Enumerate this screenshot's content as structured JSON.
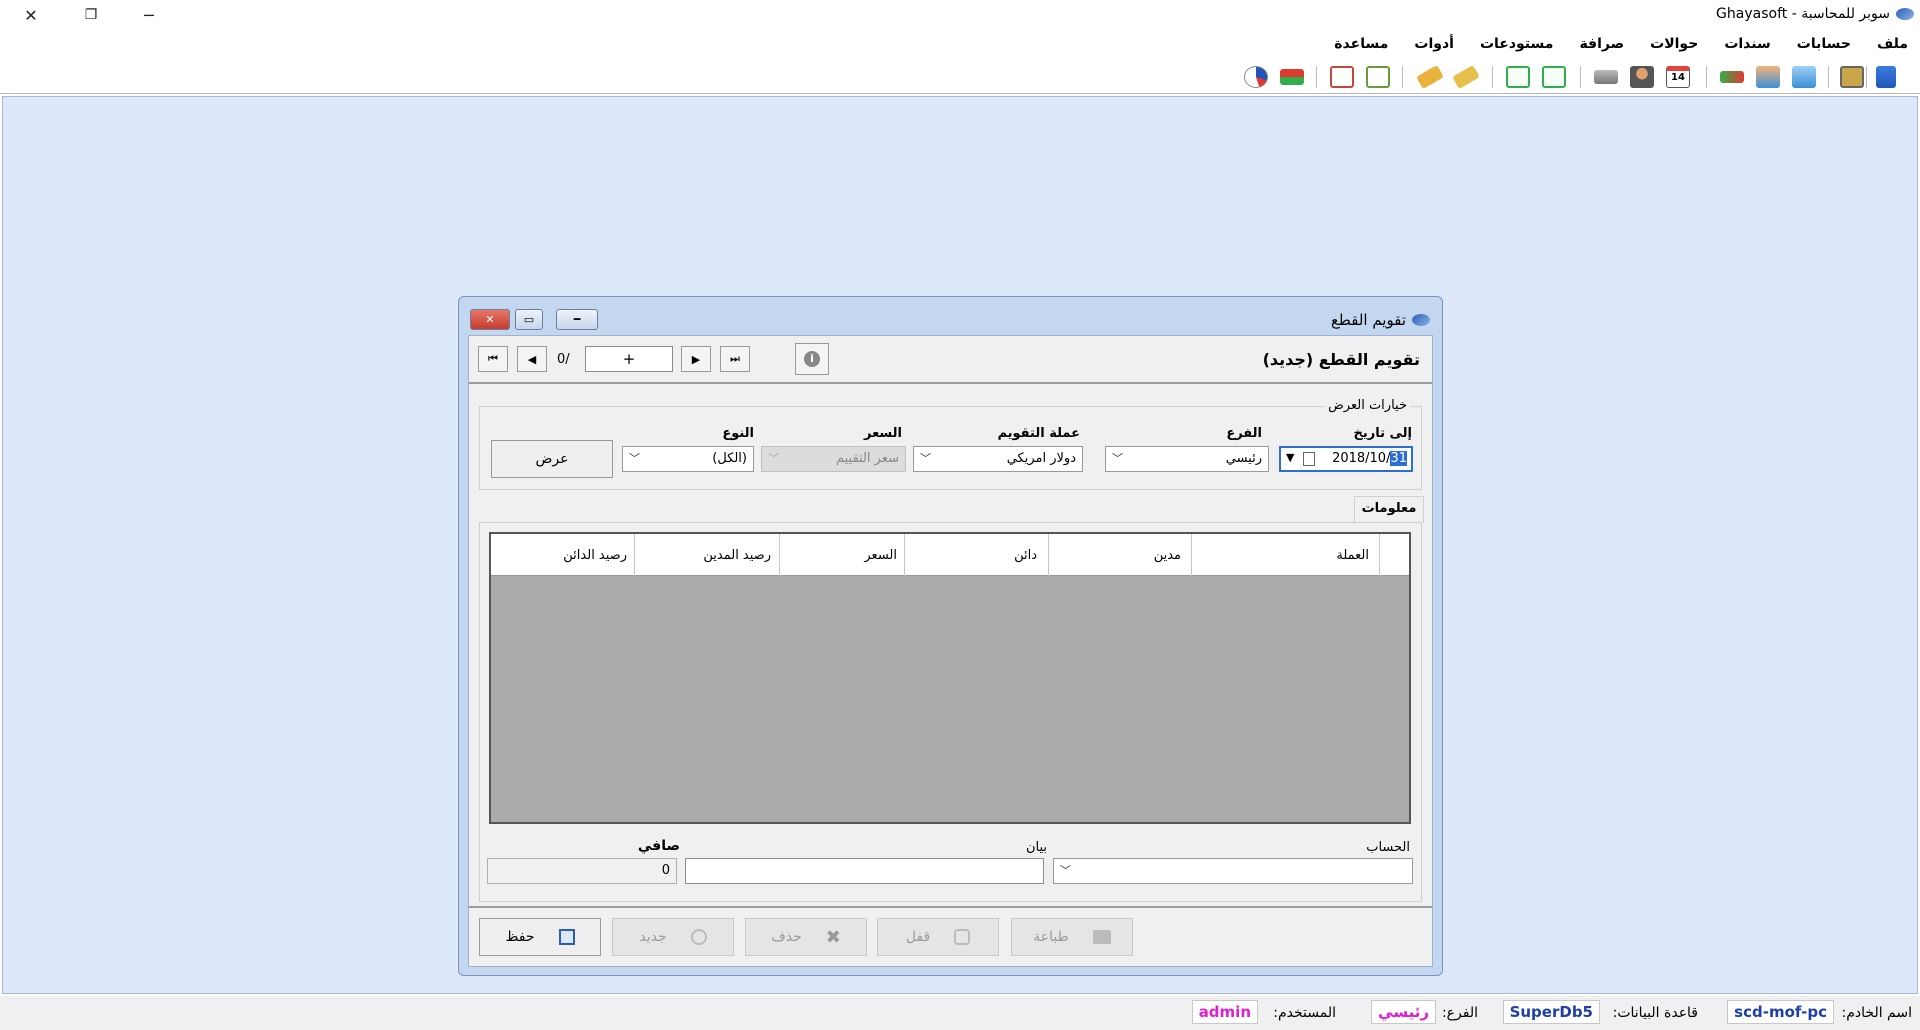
{
  "app": {
    "title": "سوبر للمحاسبة - Ghayasoft"
  },
  "window_controls": {
    "close": "✕",
    "maximize": "❐",
    "minimize": "─"
  },
  "menu": [
    "ملف",
    "حسابات",
    "سندات",
    "حوالات",
    "صرافة",
    "مستودعات",
    "أدوات",
    "مساعدة"
  ],
  "toolbar": {
    "icons": [
      "tree-icon",
      "monitor-icon",
      "download-icon",
      "upload-icon",
      "transfer-icon",
      "calendar-icon",
      "user-icon",
      "scales-icon",
      "import-icon",
      "export-icon",
      "tag-icon",
      "tag-alt-icon",
      "cart-icon",
      "cart-remove-icon",
      "flags-icon",
      "chart-icon"
    ],
    "calendar_day": "14"
  },
  "dialog": {
    "window_title": "تقويم القطع",
    "heading": "تقويم القطع (جديد)",
    "nav": {
      "first": "⏮",
      "prev": "◀",
      "count": "0/",
      "record": "+",
      "next": "▶",
      "last": "⏭",
      "info": "i"
    },
    "options": {
      "group_label": "خيارات العرض",
      "to_date_label": "إلى تاريخ",
      "to_date_value": "2018/10/",
      "to_date_selected": "31",
      "branch_label": "الفرع",
      "branch_value": "رئيسي",
      "currency_label": "عملة التقويم",
      "currency_value": "دولار امريكي",
      "rate_label": "السعر",
      "rate_value": "سعر التقييم",
      "type_label": "النوع",
      "type_value": "(الكل)",
      "show_button": "عرض"
    },
    "info_tab": "معلومات",
    "grid": {
      "columns": [
        "العملة",
        "مدين",
        "دائن",
        "السعر",
        "رصيد المدين",
        "رصيد الدائن"
      ]
    },
    "footer_fields": {
      "account_label": "الحساب",
      "statement_label": "بيان",
      "net_label": "صافي",
      "net_value": "0"
    },
    "buttons": {
      "save": "حفظ",
      "new": "جديد",
      "delete": "حذف",
      "lock": "قفل",
      "print": "طباعة"
    }
  },
  "status": {
    "server_label": "اسم الخادم:",
    "server_value": "scd-mof-pc",
    "db_label": "قاعدة البيانات:",
    "db_value": "SuperDb5",
    "branch_label": "الفرع:",
    "branch_value": "رئيسي",
    "user_label": "المستخدم:",
    "user_value": "admin"
  }
}
